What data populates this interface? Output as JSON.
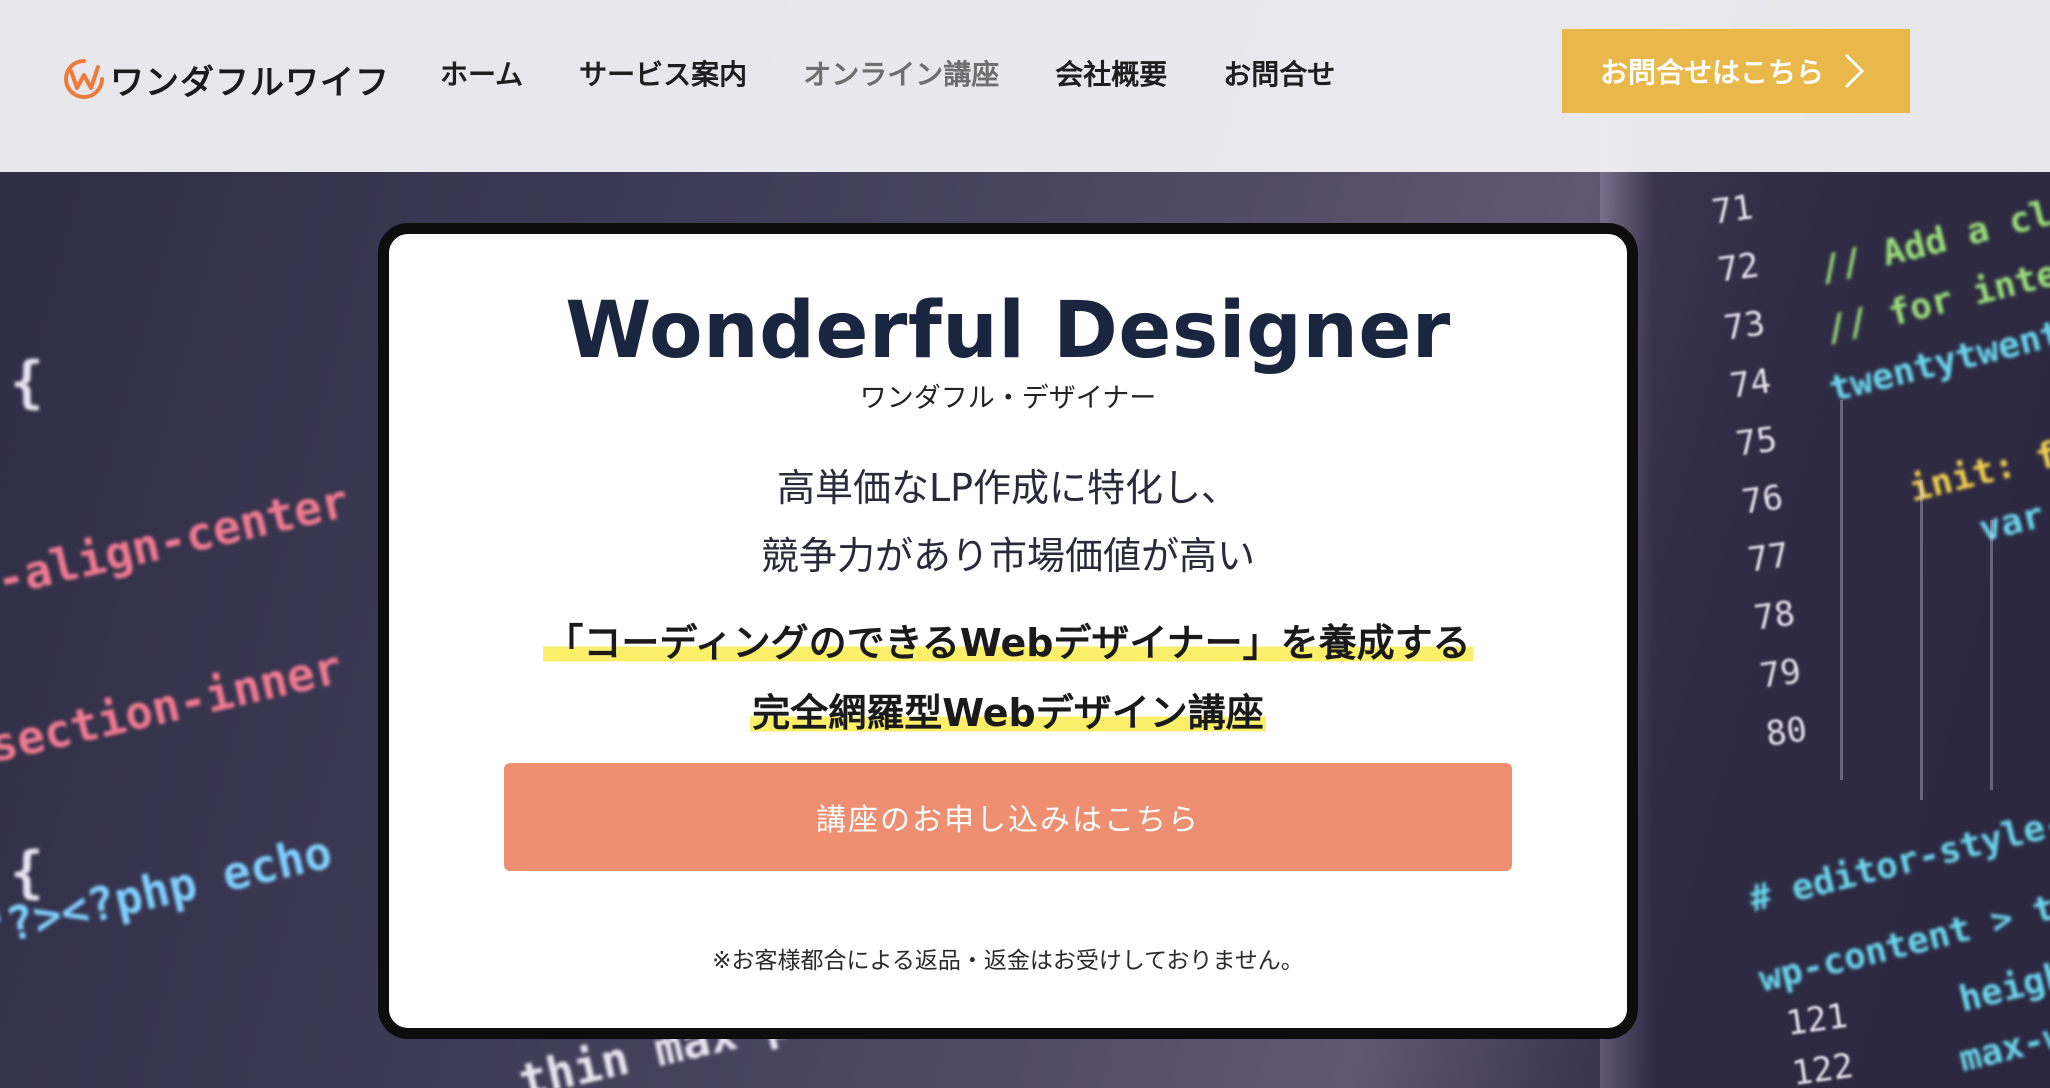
{
  "header": {
    "logo_text": "ワンダフルワイフ",
    "logo_icon": "w-circle-logo-icon",
    "nav": [
      {
        "label": "ホーム"
      },
      {
        "label": "サービス案内"
      },
      {
        "label": "オンライン講座"
      },
      {
        "label": "会社概要"
      },
      {
        "label": "お問合せ"
      }
    ],
    "active_nav_index": 2,
    "cta_label": "お問合せはこちら",
    "cta_icon": "chevron-right-icon"
  },
  "hero": {
    "title": "Wonderful Designer",
    "title_kana": "ワンダフル・デザイナー",
    "lead_line1": "高単価なLP作成に特化し、",
    "lead_line2": "競争力があり市場価値が高い",
    "highlight_line1": "「コーディングのできるWebデザイナー」を養成する",
    "highlight_line2": "完全網羅型Webデザイン講座",
    "apply_button_label": "講座のお申し込みはこちら",
    "notice": "※お客様都合による返品・返金はお受けしておりません。"
  },
  "background_code": {
    "left_lines": [
      "t-align-center",
      "section-inner",
      "\"?><?php echo",
      "thin max-po"
    ],
    "line_numbers": [
      "71",
      "72",
      "73",
      "74",
      "75",
      "76",
      "77",
      "78",
      "79",
      "80",
      "121",
      "122"
    ],
    "right_lines": [
      "// Add a class",
      "// for intera",
      "twentytwenty.",
      "init: fu",
      "var",
      "# editor-style-class",
      "wp-content > theme",
      "height",
      "max-w"
    ]
  },
  "colors": {
    "accent_yellow": "#e8b84b",
    "apply_coral": "#ee8f71",
    "highlight_yellow": "#fbef6a",
    "title_navy": "#1a2540"
  }
}
